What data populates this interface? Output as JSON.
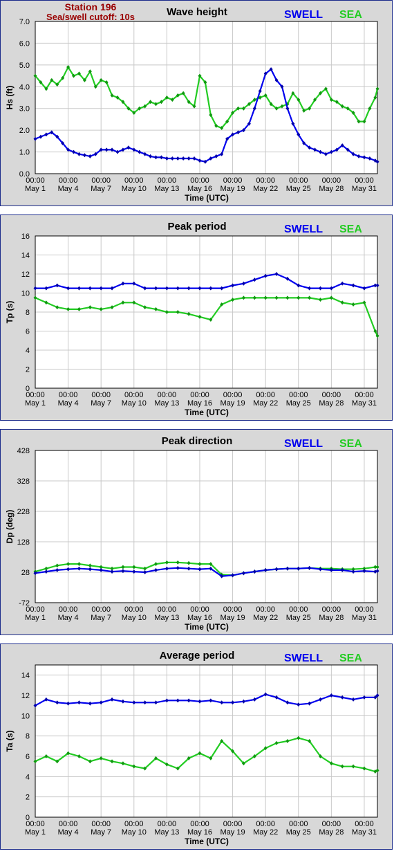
{
  "header": {
    "station": "Station 196",
    "cutoff": "Sea/swell cutoff: 10s"
  },
  "legend": {
    "swell": "SWELL",
    "sea": "SEA",
    "swell_color": "#0000ee",
    "sea_color": "#22cc22"
  },
  "x_axis": {
    "label": "Time (UTC)",
    "time_label": "00:00",
    "ticks": [
      "May 1",
      "May 4",
      "May 7",
      "May 10",
      "May 13",
      "May 16",
      "May 19",
      "May 22",
      "May 25",
      "May 28",
      "May 31"
    ],
    "tick_days": [
      1,
      4,
      7,
      10,
      13,
      16,
      19,
      22,
      25,
      28,
      31
    ],
    "range_days": [
      1,
      32.2
    ]
  },
  "chart_data": [
    {
      "type": "line",
      "title": "Wave height",
      "ylabel": "Hs (ft)",
      "ylim": [
        0,
        7
      ],
      "yticks": [
        "0.0",
        "1.0",
        "2.0",
        "3.0",
        "4.0",
        "5.0",
        "6.0",
        "7.0"
      ],
      "grid": true,
      "series": [
        {
          "name": "SWELL",
          "x": [
            1,
            1.5,
            2,
            2.5,
            3,
            3.5,
            4,
            4.5,
            5,
            5.5,
            6,
            6.5,
            7,
            7.5,
            8,
            8.5,
            9,
            9.5,
            10,
            10.5,
            11,
            11.5,
            12,
            12.5,
            13,
            13.5,
            14,
            14.5,
            15,
            15.5,
            16,
            16.5,
            17,
            17.5,
            18,
            18.5,
            19,
            19.5,
            20,
            20.5,
            21,
            21.5,
            22,
            22.5,
            23,
            23.5,
            24,
            24.5,
            25,
            25.5,
            26,
            26.5,
            27,
            27.5,
            28,
            28.5,
            29,
            29.5,
            30,
            30.5,
            31,
            31.5,
            32,
            32.2
          ],
          "values": [
            1.6,
            1.7,
            1.8,
            1.9,
            1.7,
            1.4,
            1.1,
            1.0,
            0.9,
            0.85,
            0.8,
            0.9,
            1.1,
            1.1,
            1.1,
            1.0,
            1.1,
            1.2,
            1.1,
            1.0,
            0.9,
            0.8,
            0.75,
            0.75,
            0.7,
            0.7,
            0.7,
            0.7,
            0.7,
            0.7,
            0.6,
            0.55,
            0.7,
            0.8,
            0.9,
            1.6,
            1.8,
            1.9,
            2.0,
            2.3,
            3.0,
            3.8,
            4.6,
            4.8,
            4.3,
            4.0,
            3.0,
            2.3,
            1.8,
            1.4,
            1.2,
            1.1,
            1.0,
            0.9,
            1.0,
            1.1,
            1.3,
            1.1,
            0.9,
            0.8,
            0.75,
            0.7,
            0.6,
            0.55
          ]
        },
        {
          "name": "SEA",
          "x": [
            1,
            1.5,
            2,
            2.5,
            3,
            3.5,
            4,
            4.5,
            5,
            5.5,
            6,
            6.5,
            7,
            7.5,
            8,
            8.5,
            9,
            9.5,
            10,
            10.5,
            11,
            11.5,
            12,
            12.5,
            13,
            13.5,
            14,
            14.5,
            15,
            15.5,
            16,
            16.5,
            17,
            17.5,
            18,
            18.5,
            19,
            19.5,
            20,
            20.5,
            21,
            21.5,
            22,
            22.5,
            23,
            23.5,
            24,
            24.5,
            25,
            25.5,
            26,
            26.5,
            27,
            27.5,
            28,
            28.5,
            29,
            29.5,
            30,
            30.5,
            31,
            31.5,
            32,
            32.2
          ],
          "values": [
            4.5,
            4.2,
            3.9,
            4.3,
            4.1,
            4.4,
            4.9,
            4.5,
            4.6,
            4.3,
            4.7,
            4.0,
            4.3,
            4.2,
            3.6,
            3.5,
            3.3,
            3.0,
            2.8,
            3.0,
            3.1,
            3.3,
            3.2,
            3.3,
            3.5,
            3.4,
            3.6,
            3.7,
            3.3,
            3.1,
            4.5,
            4.2,
            2.7,
            2.2,
            2.1,
            2.4,
            2.8,
            3.0,
            3.0,
            3.2,
            3.4,
            3.5,
            3.6,
            3.2,
            3.0,
            3.1,
            3.2,
            3.7,
            3.4,
            2.9,
            3.0,
            3.4,
            3.7,
            3.9,
            3.4,
            3.3,
            3.1,
            3.0,
            2.8,
            2.4,
            2.4,
            3.0,
            3.5,
            3.9
          ]
        }
      ]
    },
    {
      "type": "line",
      "title": "Peak period",
      "ylabel": "Tp (s)",
      "ylim": [
        0,
        16
      ],
      "yticks": [
        "0",
        "2",
        "4",
        "6",
        "8",
        "10",
        "12",
        "14",
        "16"
      ],
      "grid": true,
      "series": [
        {
          "name": "SWELL",
          "x": [
            1,
            2,
            3,
            4,
            5,
            6,
            7,
            8,
            9,
            10,
            11,
            12,
            13,
            14,
            15,
            16,
            17,
            18,
            19,
            20,
            21,
            22,
            23,
            24,
            25,
            26,
            27,
            28,
            29,
            30,
            31,
            32,
            32.2
          ],
          "values": [
            10.5,
            10.5,
            10.8,
            10.5,
            10.5,
            10.5,
            10.5,
            10.5,
            11.0,
            11.0,
            10.5,
            10.5,
            10.5,
            10.5,
            10.5,
            10.5,
            10.5,
            10.5,
            10.8,
            11.0,
            11.4,
            11.8,
            12.0,
            11.5,
            10.8,
            10.5,
            10.5,
            10.5,
            11.0,
            10.8,
            10.5,
            10.8,
            10.8
          ]
        },
        {
          "name": "SEA",
          "x": [
            1,
            2,
            3,
            4,
            5,
            6,
            7,
            8,
            9,
            10,
            11,
            12,
            13,
            14,
            15,
            16,
            17,
            18,
            19,
            20,
            21,
            22,
            23,
            24,
            25,
            26,
            27,
            28,
            29,
            30,
            31,
            32,
            32.2
          ],
          "values": [
            9.5,
            9.0,
            8.5,
            8.3,
            8.3,
            8.5,
            8.3,
            8.5,
            9.0,
            9.0,
            8.5,
            8.3,
            8.0,
            8.0,
            7.8,
            7.5,
            7.2,
            8.8,
            9.3,
            9.5,
            9.5,
            9.5,
            9.5,
            9.5,
            9.5,
            9.5,
            9.3,
            9.5,
            9.0,
            8.8,
            9.0,
            6.0,
            5.5
          ]
        }
      ]
    },
    {
      "type": "line",
      "title": "Peak direction",
      "ylabel": "Dp (deg)",
      "ylim": [
        -72,
        428
      ],
      "yticks": [
        "-72",
        "28",
        "128",
        "228",
        "328",
        "428"
      ],
      "grid": true,
      "series": [
        {
          "name": "SWELL",
          "x": [
            1,
            2,
            3,
            4,
            5,
            6,
            7,
            8,
            9,
            10,
            11,
            12,
            13,
            14,
            15,
            16,
            17,
            18,
            19,
            20,
            21,
            22,
            23,
            24,
            25,
            26,
            27,
            28,
            29,
            30,
            31,
            32,
            32.2
          ],
          "values": [
            25,
            30,
            35,
            38,
            40,
            38,
            35,
            30,
            32,
            30,
            28,
            35,
            40,
            42,
            40,
            38,
            40,
            15,
            18,
            25,
            30,
            35,
            38,
            40,
            40,
            42,
            38,
            35,
            35,
            30,
            32,
            30,
            32
          ]
        },
        {
          "name": "SEA",
          "x": [
            1,
            2,
            3,
            4,
            5,
            6,
            7,
            8,
            9,
            10,
            11,
            12,
            13,
            14,
            15,
            16,
            17,
            18,
            19,
            20,
            21,
            22,
            23,
            24,
            25,
            26,
            27,
            28,
            29,
            30,
            31,
            32,
            32.2
          ],
          "values": [
            30,
            40,
            50,
            55,
            55,
            50,
            45,
            40,
            45,
            45,
            40,
            55,
            60,
            60,
            58,
            55,
            55,
            20,
            18,
            25,
            30,
            35,
            38,
            40,
            40,
            42,
            40,
            40,
            38,
            38,
            40,
            45,
            45
          ]
        }
      ]
    },
    {
      "type": "line",
      "title": "Average period",
      "ylabel": "Ta (s)",
      "ylim": [
        0,
        15
      ],
      "yticks": [
        "0",
        "2",
        "4",
        "6",
        "8",
        "10",
        "12",
        "14"
      ],
      "grid": true,
      "series": [
        {
          "name": "SWELL",
          "x": [
            1,
            2,
            3,
            4,
            5,
            6,
            7,
            8,
            9,
            10,
            11,
            12,
            13,
            14,
            15,
            16,
            17,
            18,
            19,
            20,
            21,
            22,
            23,
            24,
            25,
            26,
            27,
            28,
            29,
            30,
            31,
            32,
            32.2
          ],
          "values": [
            11.0,
            11.6,
            11.3,
            11.2,
            11.3,
            11.2,
            11.3,
            11.6,
            11.4,
            11.3,
            11.3,
            11.3,
            11.5,
            11.5,
            11.5,
            11.4,
            11.5,
            11.3,
            11.3,
            11.4,
            11.6,
            12.1,
            11.8,
            11.3,
            11.1,
            11.2,
            11.6,
            12.0,
            11.8,
            11.6,
            11.8,
            11.8,
            12.0
          ]
        },
        {
          "name": "SEA",
          "x": [
            1,
            2,
            3,
            4,
            5,
            6,
            7,
            8,
            9,
            10,
            11,
            12,
            13,
            14,
            15,
            16,
            17,
            18,
            19,
            20,
            21,
            22,
            23,
            24,
            25,
            26,
            27,
            28,
            29,
            30,
            31,
            32,
            32.2
          ],
          "values": [
            5.5,
            6.0,
            5.5,
            6.3,
            6.0,
            5.5,
            5.8,
            5.5,
            5.3,
            5.0,
            4.8,
            5.8,
            5.2,
            4.8,
            5.8,
            6.3,
            5.8,
            7.5,
            6.5,
            5.3,
            6.0,
            6.8,
            7.3,
            7.5,
            7.8,
            7.5,
            6.0,
            5.3,
            5.0,
            5.0,
            4.8,
            4.5,
            4.6
          ]
        }
      ]
    }
  ]
}
